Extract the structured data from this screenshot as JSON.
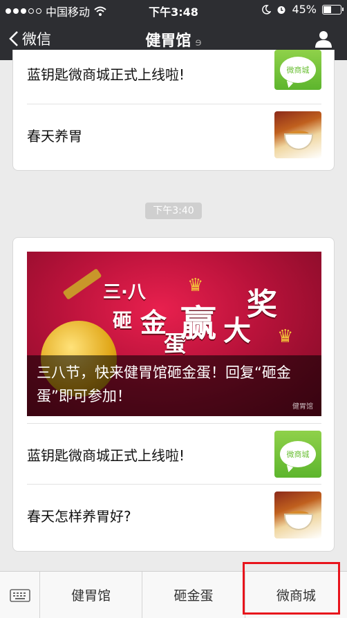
{
  "status_bar": {
    "carrier": "中国移动",
    "time": "下午3:48",
    "battery": "45%",
    "battery_level": 0.45
  },
  "nav": {
    "back_label": "微信",
    "title": "健胃馆"
  },
  "top_card": {
    "items": [
      {
        "title": "蓝钥匙微商城正式上线啦!",
        "thumb": "mall-icon"
      },
      {
        "title": "春天养胃",
        "thumb": "food-photo"
      }
    ]
  },
  "timestamp": "下午3:40",
  "article_card": {
    "banner": {
      "caption": "三八节，快来健胃馆砸金蛋！回复“砸金蛋”即可参加！",
      "text_sanba": "三·八",
      "text_za": "砸",
      "text_jin": "金",
      "text_dan": "蛋",
      "text_ying": "赢",
      "text_da": "大",
      "text_jiang": "奖",
      "watermark": "健胃馆"
    },
    "items": [
      {
        "title": "蓝钥匙微商城正式上线啦!",
        "thumb": "mall-icon",
        "thumb_text": "微商城"
      },
      {
        "title": "春天怎样养胃好?",
        "thumb": "food-photo"
      }
    ]
  },
  "menu": {
    "items": [
      "健胃馆",
      "砸金蛋",
      "微商城"
    ]
  },
  "colors": {
    "nav_bg": "#2d2e32",
    "page_bg": "#ebebeb",
    "highlight": "#e8141c",
    "mall_green": "#5db52d"
  }
}
